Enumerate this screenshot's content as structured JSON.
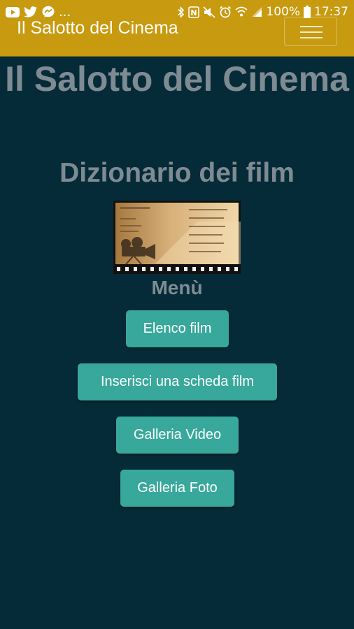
{
  "status_bar": {
    "ellipsis": "...",
    "battery": "100%",
    "time": "17:37",
    "icons": [
      "youtube-icon",
      "twitter-icon",
      "messenger-icon",
      "bluetooth-icon",
      "nfc-icon",
      "mute-icon",
      "alarm-icon",
      "wifi-icon",
      "signal-icon",
      "battery-icon"
    ]
  },
  "navbar": {
    "brand": "Il Salotto del Cinema",
    "menu_icon": "hamburger-icon"
  },
  "main": {
    "title": "Il Salotto del Cinema",
    "subtitle": "Dizionario dei film",
    "menu_label": "Menù",
    "buttons": [
      {
        "label": "Elenco film"
      },
      {
        "label": "Inserisci una scheda film"
      },
      {
        "label": "Galleria Video"
      },
      {
        "label": "Galleria Foto"
      }
    ]
  },
  "colors": {
    "background": "#062b38",
    "navbar": "#c79a10",
    "button": "#37a89b",
    "title_text": "#7f8b93"
  }
}
